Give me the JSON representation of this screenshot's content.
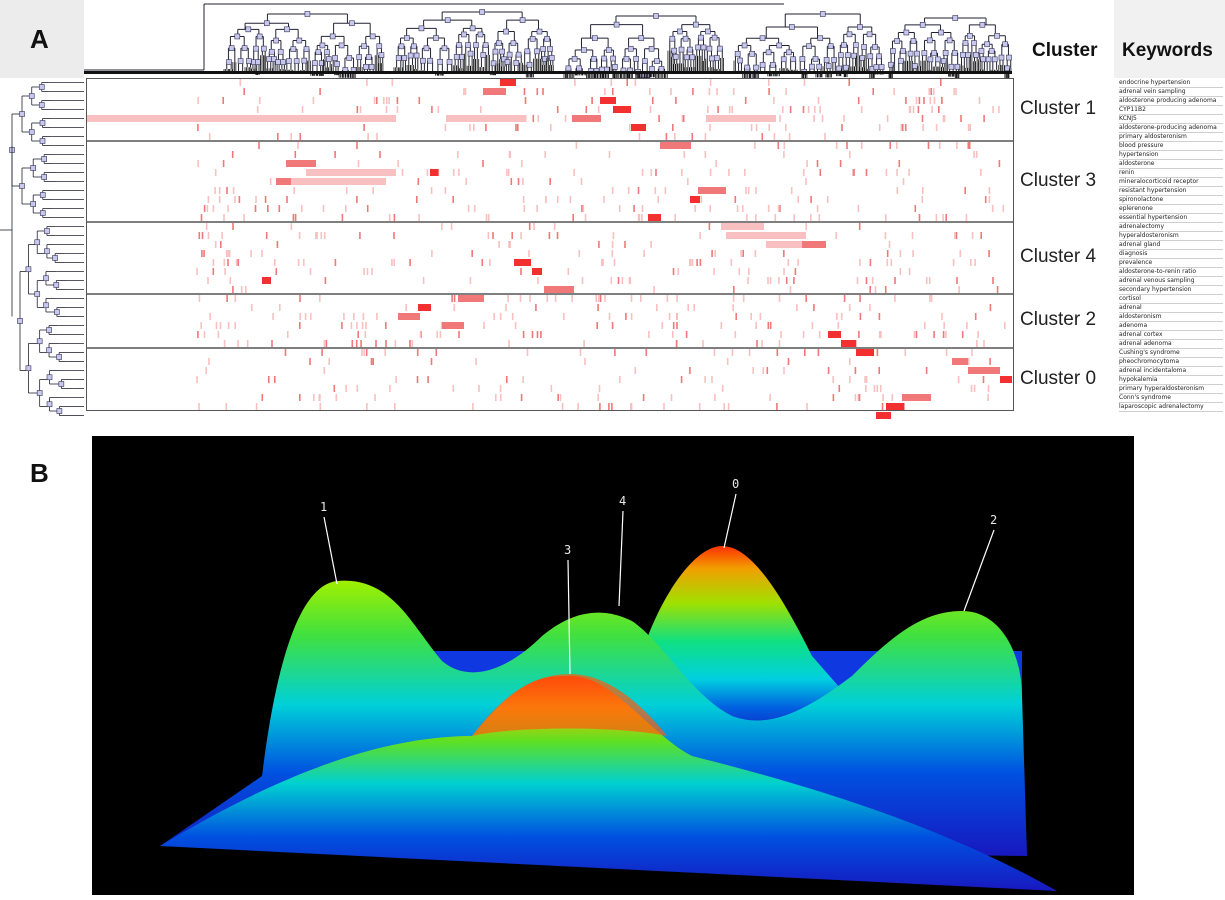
{
  "panels": {
    "a": "A",
    "b": "B"
  },
  "headers": {
    "cluster": "Cluster",
    "keywords": "Keywords"
  },
  "colors": {
    "strong": "#f23030",
    "medium": "#f07878",
    "light": "#f8c0c0",
    "faint": "#fde4e4",
    "divider": "#333333"
  },
  "chart_data": [
    {
      "type": "heatmap",
      "title": "",
      "clusters": [
        {
          "label": "Cluster 1",
          "keywords": [
            "endocrine hypertension",
            "adrenal vein sampling",
            "aldosterone producing adenoma",
            "CYP11B2",
            "KCNJ5",
            "aldosterone-producing adenoma",
            "primary aldosteronism"
          ]
        },
        {
          "label": "Cluster 3",
          "keywords": [
            "blood pressure",
            "hypertension",
            "aldosterone",
            "renin",
            "mineralocorticoid receptor",
            "resistant hypertension",
            "spironolactone",
            "eplerenone",
            "essential hypertension"
          ]
        },
        {
          "label": "Cluster 4",
          "keywords": [
            "adrenalectomy",
            "hyperaldosteronism",
            "adrenal gland",
            "diagnosis",
            "prevalence",
            "aldosterone-to-renin ratio",
            "adrenal venous sampling",
            "secondary hypertension"
          ]
        },
        {
          "label": "Cluster 2",
          "keywords": [
            "cortisol",
            "adrenal",
            "aldosteronism",
            "adenoma",
            "adrenal cortex",
            "adrenal adenoma"
          ]
        },
        {
          "label": "Cluster 0",
          "keywords": [
            "Cushing's syndrome",
            "pheochromocytoma",
            "adrenal incidentaloma",
            "hypokalemia",
            "primary hyperaldosteronism",
            "Conn's syndrome",
            "laparoscopic adrenalectomy"
          ]
        }
      ],
      "legend": "none"
    },
    {
      "type": "area",
      "title": "",
      "peaks": [
        {
          "label": "1"
        },
        {
          "label": "3"
        },
        {
          "label": "4"
        },
        {
          "label": "0"
        },
        {
          "label": "2"
        }
      ]
    }
  ]
}
